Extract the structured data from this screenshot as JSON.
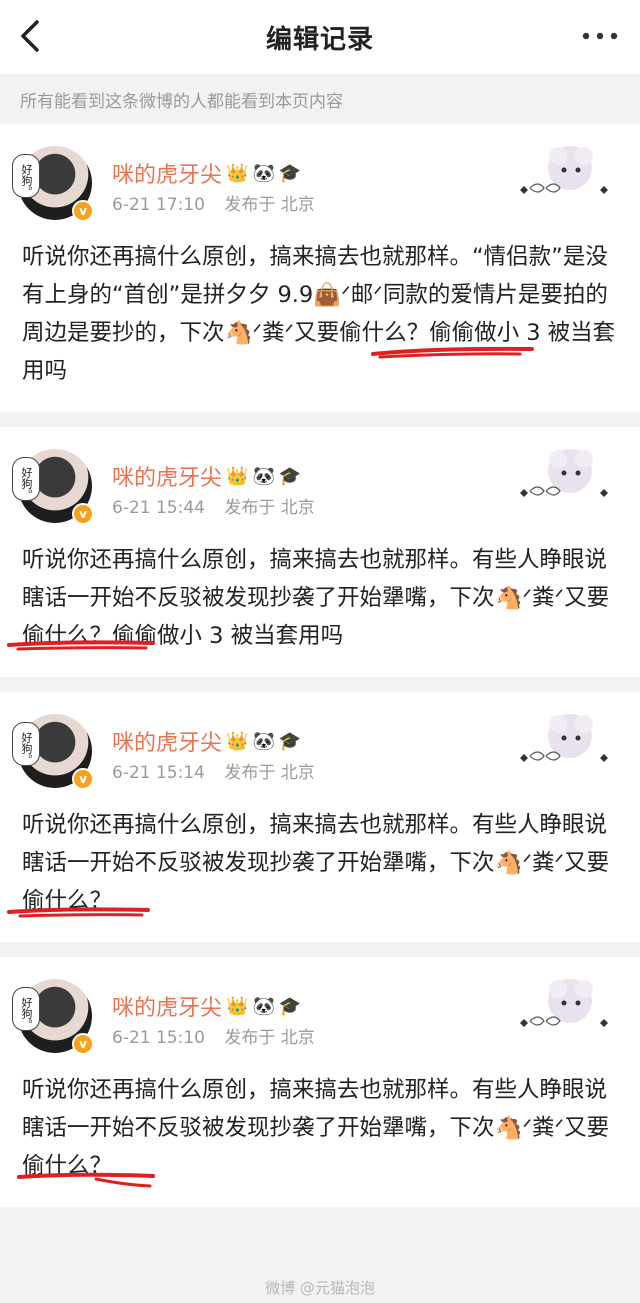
{
  "nav": {
    "title": "编辑记录",
    "back_icon": "chevron-left-icon",
    "more_icon": "more-dots-icon"
  },
  "notice": "所有能看到这条微博的人都能看到本页内容",
  "colors": {
    "username": "#eb7350",
    "meta": "#9a9a9a",
    "underline": "#e02020",
    "verified": "#f7a21b"
  },
  "records": [
    {
      "avatar_text": "好狗。",
      "username": "咪的虎牙尖",
      "badges": [
        "👑",
        "🐼",
        "🎓"
      ],
      "time": "6-21 17:10",
      "source": "发布于 北京",
      "text": "听说你还再搞什么原创，搞来搞去也就那样。“情侣款”是没有上身的“首创”是拼夕夕 9.9👜ᐟ邮ᐟ同款的爱情片是要拍的周边是要抄的，下次🐴ᐟ粪ᐟ又要偷什么？偷偷做小 3 被当套用吗"
    },
    {
      "avatar_text": "好狗。",
      "username": "咪的虎牙尖",
      "badges": [
        "👑",
        "🐼",
        "🎓"
      ],
      "time": "6-21 15:44",
      "source": "发布于 北京",
      "text": "听说你还再搞什么原创，搞来搞去也就那样。有些人睁眼说瞎话一开始不反驳被发现抄袭了开始犟嘴，下次🐴ᐟ粪ᐟ又要偷什么？偷偷做小 3 被当套用吗"
    },
    {
      "avatar_text": "好狗。",
      "username": "咪的虎牙尖",
      "badges": [
        "👑",
        "🐼",
        "🎓"
      ],
      "time": "6-21 15:14",
      "source": "发布于 北京",
      "text": "听说你还再搞什么原创，搞来搞去也就那样。有些人睁眼说瞎话一开始不反驳被发现抄袭了开始犟嘴，下次🐴ᐟ粪ᐟ又要偷什么？"
    },
    {
      "avatar_text": "好狗。",
      "username": "咪的虎牙尖",
      "badges": [
        "👑",
        "🐼",
        "🎓"
      ],
      "time": "6-21 15:10",
      "source": "发布于 北京",
      "text": "听说你还再搞什么原创，搞来搞去也就那样。有些人睁眼说瞎话一开始不反驳被发现抄袭了开始犟嘴，下次🐴ᐟ粪ᐟ又要偷什么？"
    }
  ],
  "footer": "微博 @元猫泡泡"
}
